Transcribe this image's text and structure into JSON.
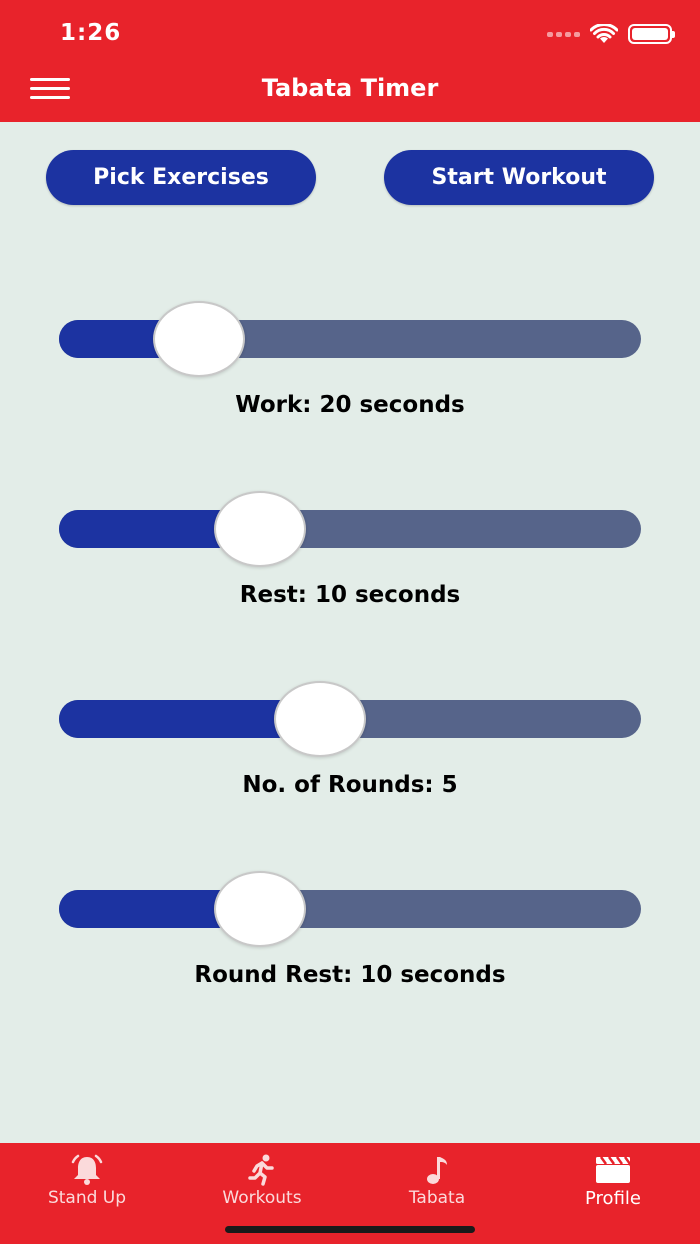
{
  "status": {
    "time": "1:26"
  },
  "header": {
    "title": "Tabata Timer"
  },
  "actions": {
    "pick_label": "Pick Exercises",
    "start_label": "Start Workout"
  },
  "sliders": [
    {
      "label": "Work: 20 seconds",
      "fraction": 0.24
    },
    {
      "label": "Rest: 10 seconds",
      "fraction": 0.345
    },
    {
      "label": "No. of Rounds: 5",
      "fraction": 0.448
    },
    {
      "label": "Round Rest: 10 seconds",
      "fraction": 0.345
    }
  ],
  "tabs": [
    {
      "label": "Stand Up",
      "icon": "bell-icon"
    },
    {
      "label": "Workouts",
      "icon": "running-icon"
    },
    {
      "label": "Tabata",
      "icon": "music-note-icon"
    },
    {
      "label": "Profile",
      "icon": "clapperboard-icon"
    }
  ],
  "colors": {
    "accent": "#E8232B",
    "primary": "#1C33A1",
    "track": "#56648A",
    "background": "#E3EDE8"
  }
}
